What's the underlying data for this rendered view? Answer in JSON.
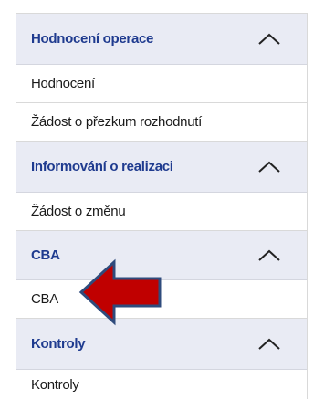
{
  "sections": [
    {
      "title": "Hodnocení operace",
      "items": [
        "Hodnocení",
        "Žádost o přezkum rozhodnutí"
      ]
    },
    {
      "title": "Informování o realizaci",
      "items": [
        "Žádost o změnu"
      ]
    },
    {
      "title": "CBA",
      "items": [
        "CBA"
      ]
    },
    {
      "title": "Kontroly",
      "items": [
        "Kontroly"
      ]
    }
  ],
  "icons": {
    "section_toggle": "chevron-up-icon",
    "pointer": "red-arrow-left-icon"
  },
  "colors": {
    "section_bg": "#e9ebf4",
    "section_text": "#1f3b8f",
    "arrow_fill": "#c00000",
    "arrow_outline": "#2f4b7c"
  }
}
